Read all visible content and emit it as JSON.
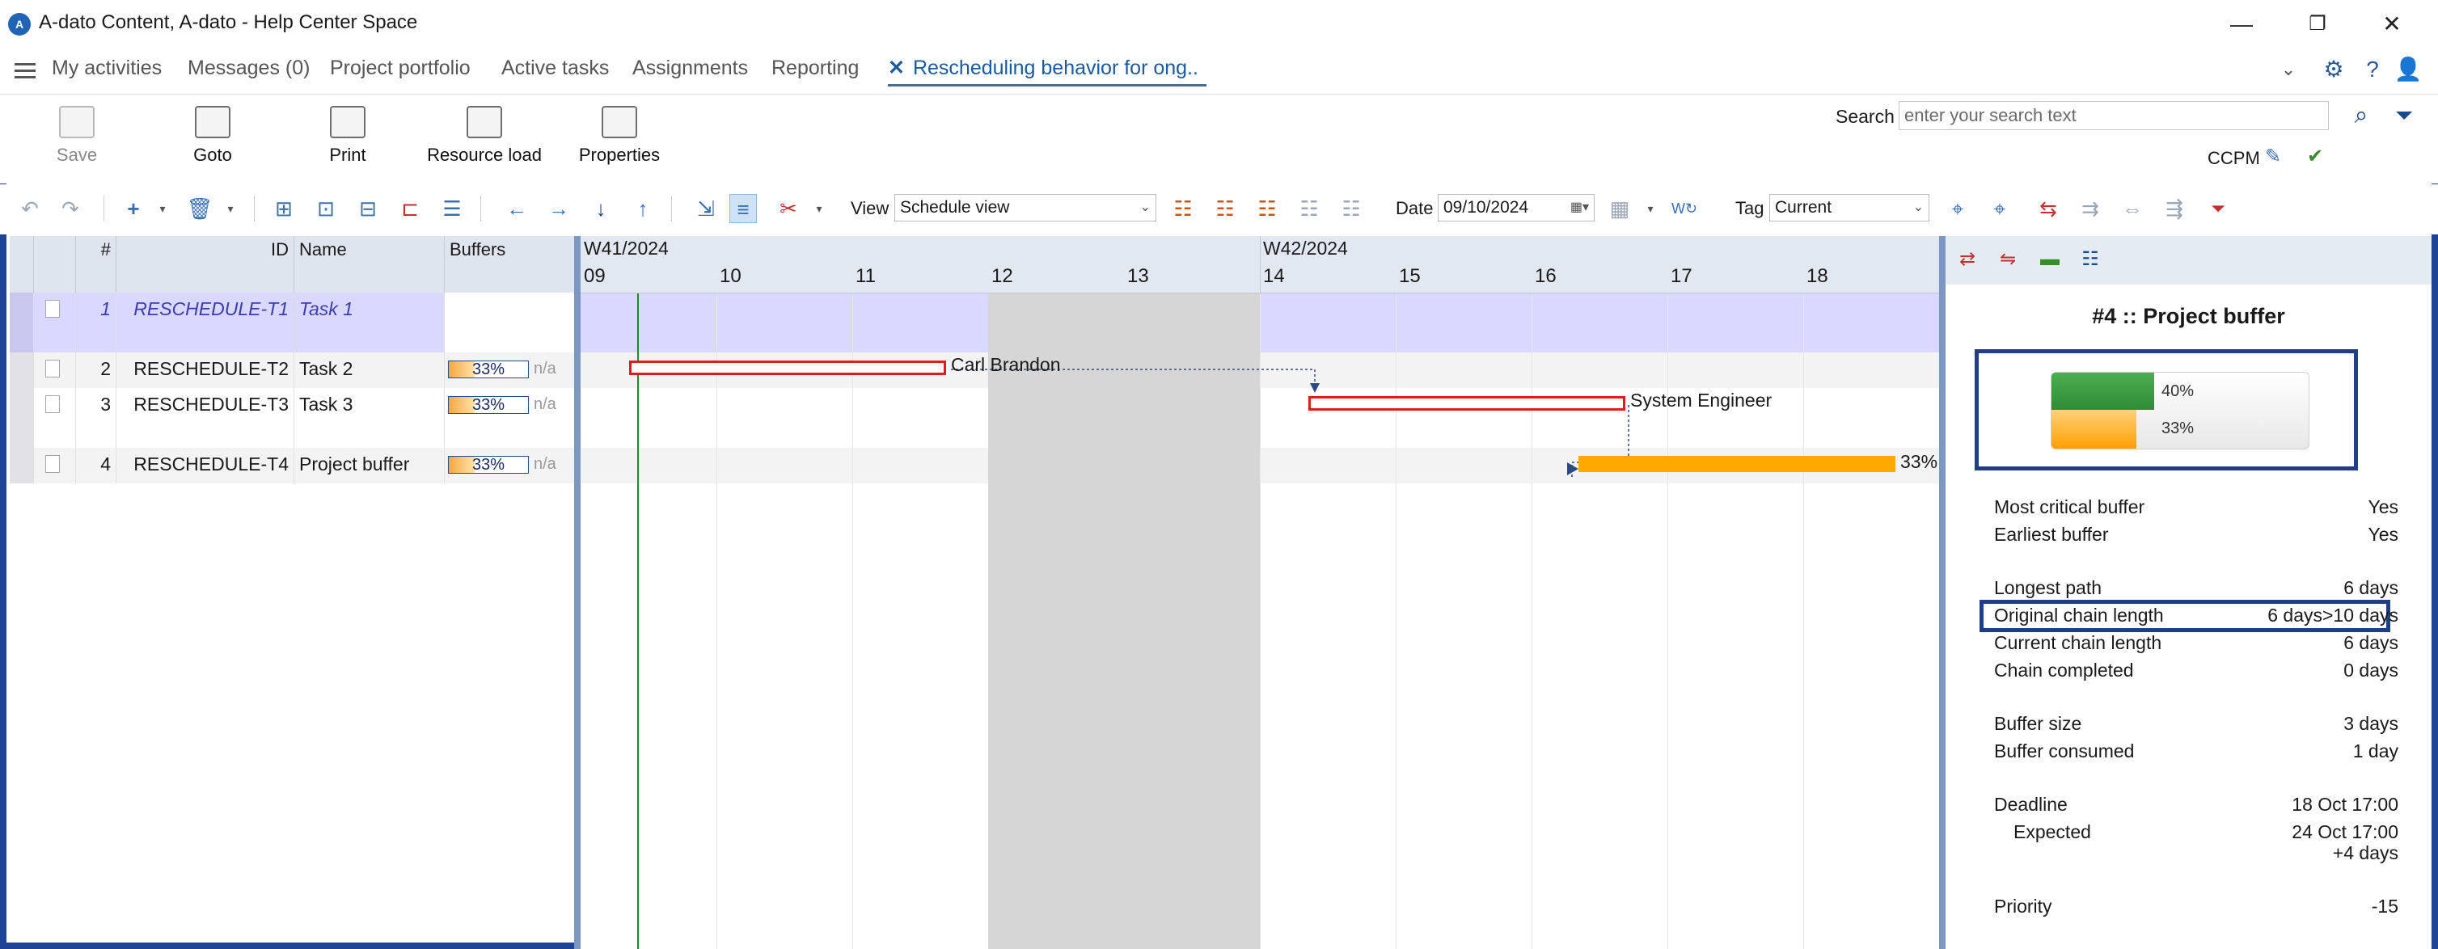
{
  "window": {
    "title": "A-dato Content, A-dato - Help Center Space",
    "logo_text": "A",
    "minimize": "—",
    "restore": "❐",
    "close": "✕"
  },
  "nav": {
    "items": [
      "My activities",
      "Messages (0)",
      "Project portfolio",
      "Active tasks",
      "Assignments",
      "Reporting"
    ],
    "active_tab": "Rescheduling behavior for ong..",
    "active_close": "✕"
  },
  "ribbon": {
    "save": "Save",
    "goto": "Goto",
    "print": "Print",
    "resource_load": "Resource load",
    "properties": "Properties",
    "search_label": "Search",
    "search_placeholder": "enter your search text",
    "ccpm_label": "CCPM"
  },
  "toolbar": {
    "view_label": "View",
    "view_value": "Schedule view",
    "date_label": "Date",
    "date_value": "09/10/2024",
    "tag_label": "Tag",
    "tag_value": "Current"
  },
  "grid": {
    "headers": {
      "num": "#",
      "id": "ID",
      "name": "Name",
      "buffers": "Buffers"
    },
    "rows": [
      {
        "num": "1",
        "id": "RESCHEDULE-T1",
        "name": "Task 1",
        "buffer": "",
        "na": ""
      },
      {
        "num": "2",
        "id": "RESCHEDULE-T2",
        "name": "Task 2",
        "buffer": "33%",
        "na": "n/a",
        "fill": 0.33
      },
      {
        "num": "3",
        "id": "RESCHEDULE-T3",
        "name": "Task 3",
        "buffer": "33%",
        "na": "n/a",
        "fill": 0.33
      },
      {
        "num": "4",
        "id": "RESCHEDULE-T4",
        "name": "Project buffer",
        "buffer": "33%",
        "na": "n/a",
        "fill": 0.33
      }
    ]
  },
  "gantt": {
    "weeks": [
      "W41/2024",
      "W42/2024"
    ],
    "days": [
      "09",
      "10",
      "11",
      "12",
      "13",
      "14",
      "15",
      "16",
      "17",
      "18"
    ],
    "task2_resource": "Carl Brandon",
    "task3_resource": "System Engineer",
    "buffer_label": "33%"
  },
  "panel": {
    "title": "#4 :: Project buffer",
    "fever_chain": "40%",
    "fever_buffer": "33%",
    "fever_chain_fill": 0.4,
    "fever_buffer_fill": 0.33,
    "props": [
      {
        "label": "Most critical buffer",
        "value": "Yes"
      },
      {
        "label": "Earliest buffer",
        "value": "Yes"
      },
      {
        "label": "Longest path",
        "value": "6 days"
      },
      {
        "label": "Original chain length",
        "value": "6 days>10 days"
      },
      {
        "label": "Current chain length",
        "value": "6 days"
      },
      {
        "label": "Chain completed",
        "value": "0 days"
      },
      {
        "label": "Buffer size",
        "value": "3 days"
      },
      {
        "label": "Buffer consumed",
        "value": "1 day"
      },
      {
        "label": "Deadline",
        "value": "18 Oct 17:00"
      },
      {
        "label": "Expected",
        "value": "24 Oct 17:00"
      },
      {
        "label": "",
        "value": "+4 days"
      },
      {
        "label": "Priority",
        "value": "-15"
      }
    ]
  },
  "colors": {
    "frame": "#1e4496",
    "accent": "#1a5a9e",
    "task_border": "#e21a1a",
    "buffer_bar": "#ffa800",
    "today_line": "#1f8a2c",
    "summary_row": "#d9d9ff"
  }
}
